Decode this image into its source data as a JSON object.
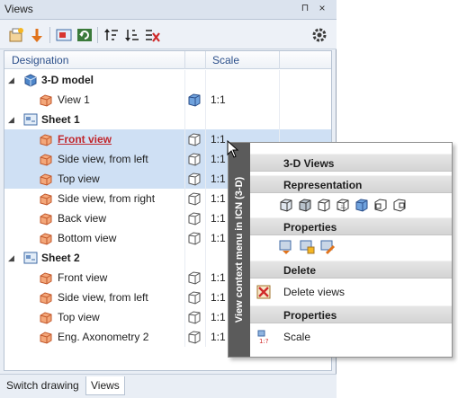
{
  "panel": {
    "title": "Views",
    "pin_glyph": "⊓",
    "close_glyph": "×"
  },
  "toolbar": {
    "icons": [
      "new-view-icon",
      "orange-arrow-down-icon",
      "sheet-view-icon",
      "refresh-icon",
      "sort-up-icon",
      "sort-down-icon",
      "delete-filter-icon",
      "settings-gear-icon"
    ]
  },
  "tree": {
    "columns": {
      "designation": "Designation",
      "scale": "Scale"
    },
    "rows": [
      {
        "label": "3-D model",
        "level": 0,
        "expanded": true,
        "bold": true,
        "icon": "3d-model-icon"
      },
      {
        "label": "View 1",
        "level": 1,
        "scale": "1:1",
        "icon": "view-icon",
        "repr": "shaded-cube-icon"
      },
      {
        "label": "Sheet 1",
        "level": 0,
        "expanded": true,
        "bold": true,
        "icon": "sheet-icon"
      },
      {
        "label": "Front view",
        "level": 1,
        "scale": "1:1",
        "icon": "view-icon",
        "repr": "wireframe-cube-icon",
        "selected": true,
        "active": true
      },
      {
        "label": "Side view, from left",
        "level": 1,
        "scale": "1:1",
        "icon": "view-icon",
        "repr": "wireframe-cube-icon",
        "selected": true
      },
      {
        "label": "Top view",
        "level": 1,
        "scale": "1:1",
        "icon": "view-icon",
        "repr": "wireframe-cube-icon",
        "selected": true
      },
      {
        "label": "Side view, from right",
        "level": 1,
        "scale": "1:1",
        "icon": "view-icon",
        "repr": "wireframe-cube-icon"
      },
      {
        "label": "Back view",
        "level": 1,
        "scale": "1:1",
        "icon": "view-icon",
        "repr": "wireframe-cube-icon"
      },
      {
        "label": "Bottom view",
        "level": 1,
        "scale": "1:1",
        "icon": "view-icon",
        "repr": "wireframe-cube-icon"
      },
      {
        "label": "Sheet 2",
        "level": 0,
        "expanded": true,
        "bold": true,
        "icon": "sheet-icon"
      },
      {
        "label": "Front view",
        "level": 1,
        "scale": "1:1",
        "icon": "view-icon",
        "repr": "wireframe-cube-icon"
      },
      {
        "label": "Side view, from left",
        "level": 1,
        "scale": "1:1",
        "icon": "view-icon",
        "repr": "wireframe-cube-icon"
      },
      {
        "label": "Top view",
        "level": 1,
        "scale": "1:1",
        "icon": "view-icon",
        "repr": "wireframe-cube-icon"
      },
      {
        "label": "Eng. Axonometry 2",
        "level": 1,
        "scale": "1:1",
        "icon": "view-icon",
        "repr": "wireframe-cube-icon"
      }
    ]
  },
  "bottom_tabs": [
    {
      "label": "Switch drawing",
      "active": false
    },
    {
      "label": "Views",
      "active": true
    }
  ],
  "context_menu": {
    "side_label": "View context menu in ICN (3-D)",
    "sections": {
      "views3d": "3-D Views",
      "representation": "Representation",
      "properties1": "Properties",
      "delete": "Delete",
      "properties2": "Properties"
    },
    "items": {
      "delete_views": "Delete views",
      "scale": "Scale"
    },
    "representation_icons": [
      "hidden-lines-cube-icon",
      "shaded-edges-cube-icon",
      "wireframe-cube-icon",
      "hidden-dashed-cube-icon",
      "shaded-cube-icon",
      "dimension-cube-icon",
      "front-cube-icon"
    ],
    "property_icons": [
      "view-properties-icon",
      "view-properties-lock-icon",
      "view-properties-edit-icon"
    ]
  },
  "colors": {
    "selection": "#cfe0f4",
    "active_view": "#c1272d",
    "header_text": "#2b4f8a",
    "menu_band": "#5b5b5b"
  }
}
